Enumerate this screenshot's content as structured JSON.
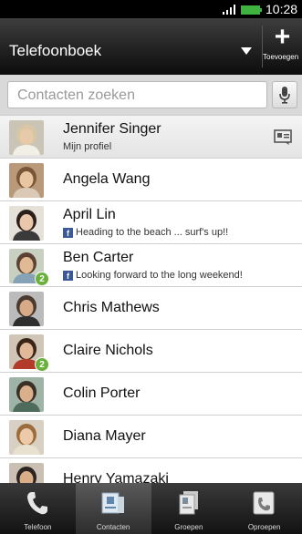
{
  "status": {
    "time": "10:28"
  },
  "header": {
    "title": "Telefoonboek",
    "add_label": "Toevoegen"
  },
  "search": {
    "placeholder": "Contacten zoeken"
  },
  "contacts": [
    {
      "name": "Jennifer Singer",
      "subtext": "Mijn profiel",
      "facebook": false,
      "badge": null,
      "profile": true
    },
    {
      "name": "Angela Wang",
      "subtext": null,
      "facebook": false,
      "badge": null,
      "profile": false
    },
    {
      "name": "April Lin",
      "subtext": "Heading to the beach ... surf's up!!",
      "facebook": true,
      "badge": null,
      "profile": false
    },
    {
      "name": "Ben Carter",
      "subtext": "Looking forward to the long weekend!",
      "facebook": true,
      "badge": "2",
      "profile": false
    },
    {
      "name": "Chris Mathews",
      "subtext": null,
      "facebook": false,
      "badge": null,
      "profile": false
    },
    {
      "name": "Claire Nichols",
      "subtext": null,
      "facebook": false,
      "badge": "2",
      "profile": false
    },
    {
      "name": "Colin Porter",
      "subtext": null,
      "facebook": false,
      "badge": null,
      "profile": false
    },
    {
      "name": "Diana Mayer",
      "subtext": null,
      "facebook": false,
      "badge": null,
      "profile": false
    },
    {
      "name": "Henry Yamazaki",
      "subtext": null,
      "facebook": false,
      "badge": null,
      "profile": false
    }
  ],
  "nav": [
    {
      "label": "Telefoon",
      "icon": "phone-icon",
      "active": false
    },
    {
      "label": "Contacten",
      "icon": "contacts-icon",
      "active": true
    },
    {
      "label": "Groepen",
      "icon": "groups-icon",
      "active": false
    },
    {
      "label": "Oproepen",
      "icon": "call-history-icon",
      "active": false
    }
  ],
  "colors": {
    "accent_green": "#6ab13b",
    "facebook_blue": "#3b5998"
  }
}
